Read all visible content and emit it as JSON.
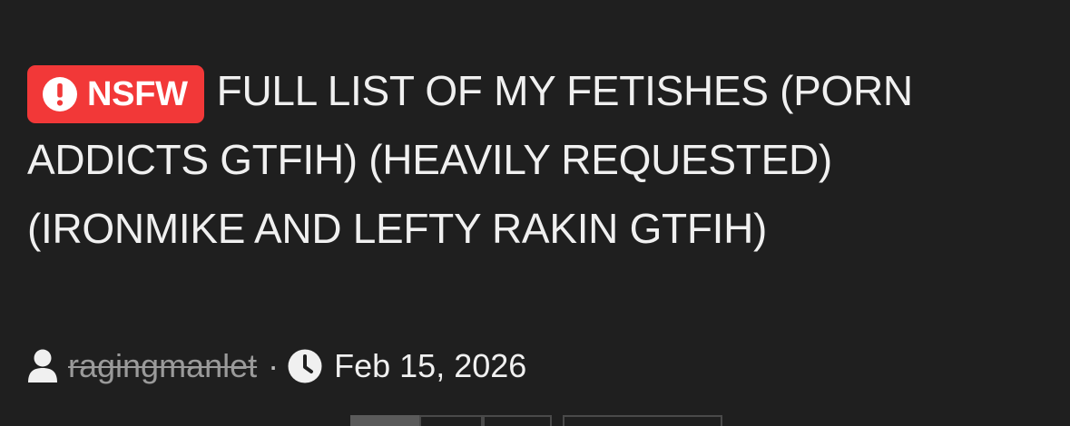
{
  "badge": {
    "label": "NSFW",
    "icon": "exclamation-circle-icon",
    "color": "#f23838"
  },
  "thread": {
    "title": "FULL LIST OF MY FETISHES (PORN ADDICTS GTFIH) (HEAVILY REQUESTED) (IRONMIKE AND LEFTY RAKIN GTFIH)"
  },
  "meta": {
    "user_icon": "user-icon",
    "username": "ragingmanlet",
    "separator": "·",
    "time_icon": "clock-icon",
    "date": "Feb 15, 2026"
  },
  "colors": {
    "background": "#1f1f1f",
    "text": "#f0f0f0",
    "muted": "#9a9a9a"
  }
}
